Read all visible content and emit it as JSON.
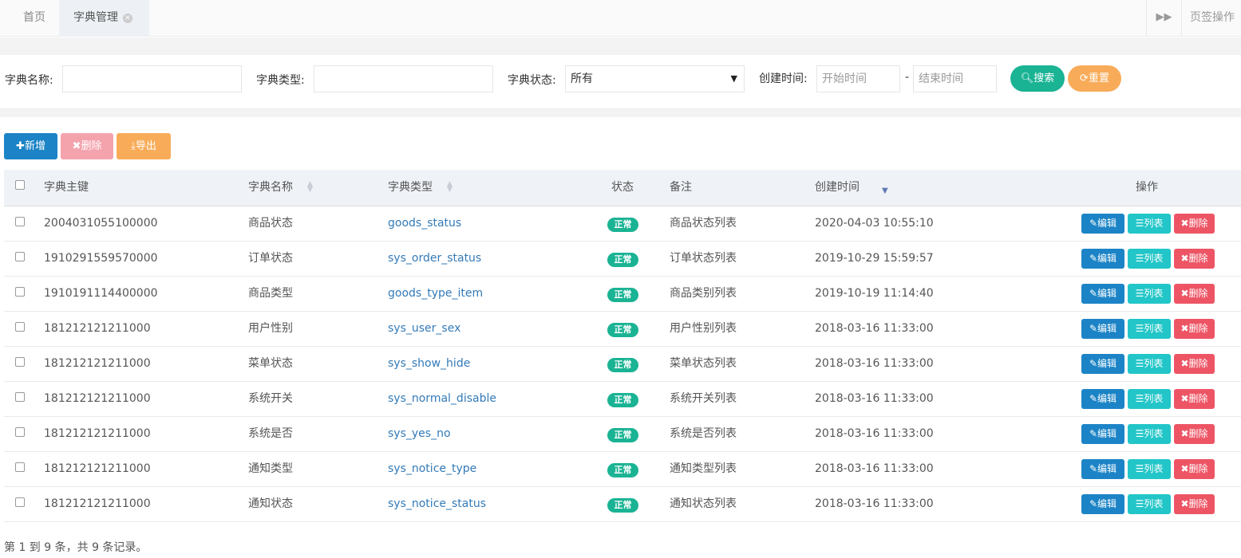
{
  "tabs": {
    "home": "首页",
    "dict": "字典管理",
    "close_icon": "⊗",
    "forward_icon": "▶▶",
    "ops": "页签操作"
  },
  "search": {
    "dict_name_label": "字典名称:",
    "dict_type_label": "字典类型:",
    "dict_status_label": "字典状态:",
    "dict_status_value": "所有",
    "created_label": "创建时间:",
    "start_placeholder": "开始时间",
    "end_placeholder": "结束时间",
    "dash": "-",
    "search_btn": "搜索",
    "reset_btn": "重置"
  },
  "toolbar": {
    "add": "新增",
    "delete": "删除",
    "export": "导出"
  },
  "table": {
    "headers": {
      "id": "字典主键",
      "name": "字典名称",
      "type": "字典类型",
      "status": "状态",
      "remark": "备注",
      "created": "创建时间",
      "ops": "操作"
    },
    "rows": [
      {
        "id": "2004031055100000",
        "name": "商品状态",
        "type": "goods_status",
        "status": "正常",
        "remark": "商品状态列表",
        "created": "2020-04-03 10:55:10"
      },
      {
        "id": "1910291559570000",
        "name": "订单状态",
        "type": "sys_order_status",
        "status": "正常",
        "remark": "订单状态列表",
        "created": "2019-10-29 15:59:57"
      },
      {
        "id": "1910191114400000",
        "name": "商品类型",
        "type": "goods_type_item",
        "status": "正常",
        "remark": "商品类别列表",
        "created": "2019-10-19 11:14:40"
      },
      {
        "id": "181212121211000",
        "name": "用户性别",
        "type": "sys_user_sex",
        "status": "正常",
        "remark": "用户性别列表",
        "created": "2018-03-16 11:33:00"
      },
      {
        "id": "181212121211000",
        "name": "菜单状态",
        "type": "sys_show_hide",
        "status": "正常",
        "remark": "菜单状态列表",
        "created": "2018-03-16 11:33:00"
      },
      {
        "id": "181212121211000",
        "name": "系统开关",
        "type": "sys_normal_disable",
        "status": "正常",
        "remark": "系统开关列表",
        "created": "2018-03-16 11:33:00"
      },
      {
        "id": "181212121211000",
        "name": "系统是否",
        "type": "sys_yes_no",
        "status": "正常",
        "remark": "系统是否列表",
        "created": "2018-03-16 11:33:00"
      },
      {
        "id": "181212121211000",
        "name": "通知类型",
        "type": "sys_notice_type",
        "status": "正常",
        "remark": "通知类型列表",
        "created": "2018-03-16 11:33:00"
      },
      {
        "id": "181212121211000",
        "name": "通知状态",
        "type": "sys_notice_status",
        "status": "正常",
        "remark": "通知状态列表",
        "created": "2018-03-16 11:33:00"
      }
    ],
    "row_ops": {
      "edit": "编辑",
      "list": "列表",
      "delete": "删除"
    }
  },
  "footer": "第 1 到 9 条，共 9 条记录。",
  "colors": {
    "primary": "#1c84c6",
    "success": "#1ab394",
    "warning": "#f8ac59",
    "danger": "#ed5565",
    "info": "#23c6c8"
  }
}
